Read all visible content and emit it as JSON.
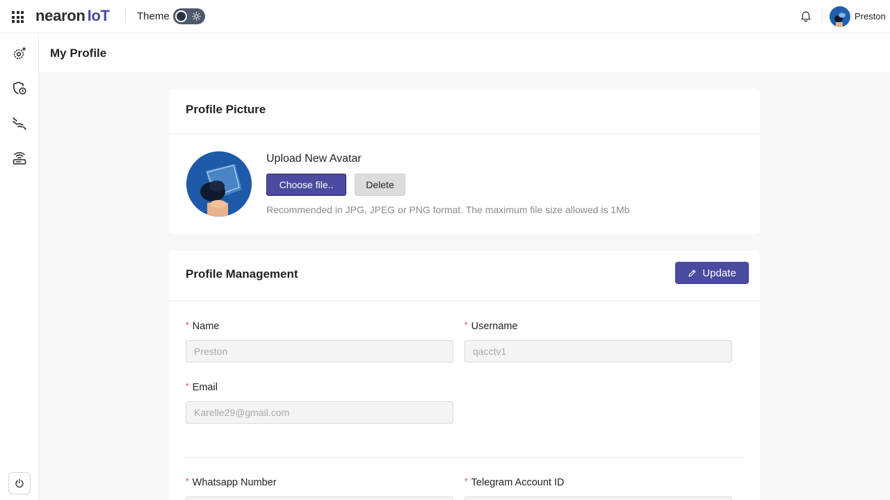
{
  "header": {
    "brand_main": "nearon",
    "brand_sub": "IoT",
    "theme_label": "Theme",
    "user_name": "Preston"
  },
  "page": {
    "title": "My Profile"
  },
  "profile_picture": {
    "title": "Profile Picture",
    "upload_title": "Upload New Avatar",
    "choose_label": "Choose file..",
    "delete_label": "Delete",
    "hint": "Recommended in JPG, JPEG or PNG format. The maximum file size allowed is 1Mb"
  },
  "profile_management": {
    "title": "Profile Management",
    "update_label": "Update",
    "fields": {
      "name": {
        "label": "Name",
        "value": "Preston"
      },
      "username": {
        "label": "Username",
        "value": "qacctv1"
      },
      "email": {
        "label": "Email",
        "value": "Karelle29@gmail.com"
      },
      "whatsapp": {
        "label": "Whatsapp Number",
        "value": ""
      },
      "telegram": {
        "label": "Telegram Account ID",
        "value": ""
      }
    }
  },
  "colors": {
    "accent": "#4a4aa0",
    "required": "#e53935",
    "background": "#f6f7fb"
  },
  "icons": {
    "apps": "apps-grid-icon",
    "notifications": "bell-icon",
    "sidebar": [
      "settings-gear-icon",
      "shield-clock-icon",
      "signal-waves-icon",
      "router-icon"
    ],
    "power": "power-icon",
    "update": "edit-pencil-icon"
  }
}
